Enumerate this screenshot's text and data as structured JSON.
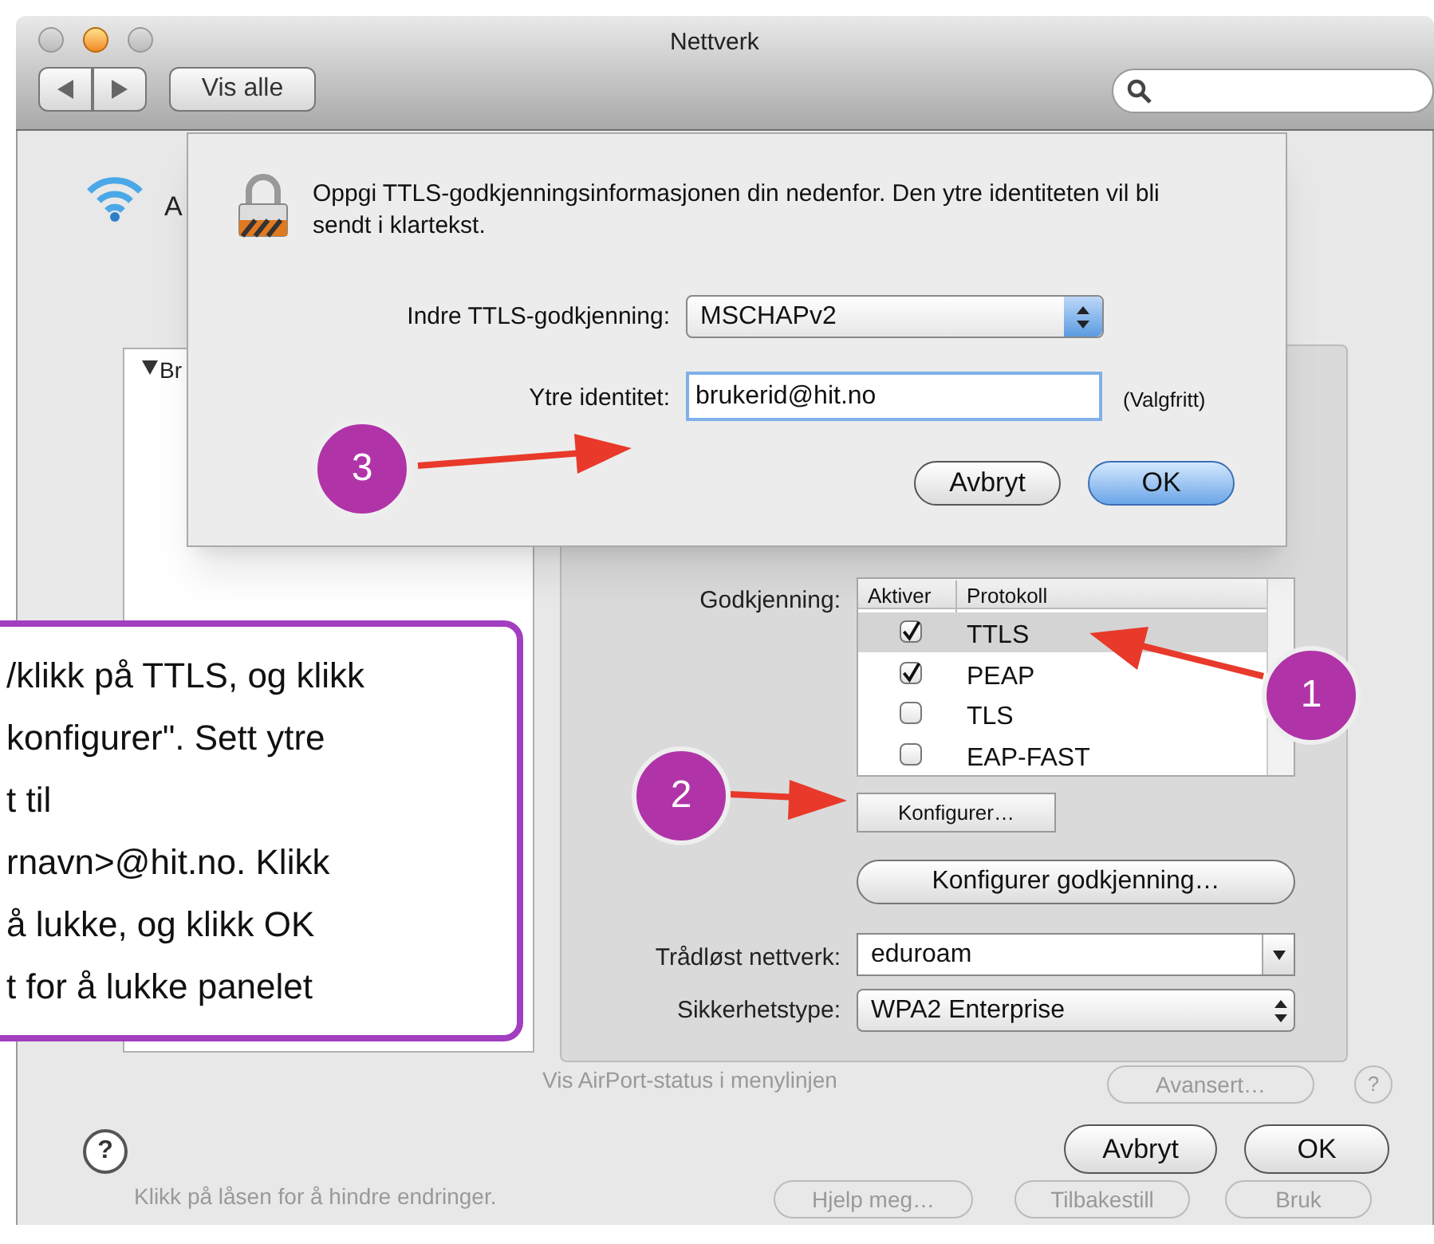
{
  "window": {
    "title": "Nettverk",
    "show_all": "Vis alle"
  },
  "background": {
    "service_label": "A",
    "show_status": "Vis AirPort-status i menylinjen",
    "advanced": "Avansert…",
    "help": "?",
    "lock_text": "Klikk på låsen for å hindre endringer.",
    "buttons": [
      "Hjelp meg…",
      "Tilbakestill",
      "Bruk"
    ]
  },
  "config_sheet": {
    "profiles": {
      "heading": "Br"
    },
    "authentication_label": "Godkjenning:",
    "table_columns": [
      "Aktiver",
      "Protokoll"
    ],
    "protocols": [
      {
        "protocol": "TTLS",
        "checked": true,
        "selected": true
      },
      {
        "protocol": "PEAP",
        "checked": true,
        "selected": false
      },
      {
        "protocol": "TLS",
        "checked": false,
        "selected": false
      },
      {
        "protocol": "EAP-FAST",
        "checked": false,
        "selected": false
      }
    ],
    "configure_button": "Konfigurer…",
    "configure_auth_button": "Konfigurer godkjenning…",
    "network_label": "Trådløst nettverk:",
    "network_value": "eduroam",
    "security_label": "Sikkerhetstype:",
    "security_value": "WPA2 Enterprise",
    "help": "?",
    "buttons": [
      {
        "label": "Avbryt",
        "default": false
      },
      {
        "label": "OK",
        "default": false
      }
    ]
  },
  "ttls_sheet": {
    "message": "Oppgi TTLS-godkjenningsinformasjonen din nedenfor. Den ytre identiteten vil bli sendt i klartekst.",
    "inner_label": "Indre TTLS-godkjenning:",
    "inner_value": "MSCHAPv2",
    "outer_label": "Ytre identitet:",
    "outer_value": "brukerid@hit.no",
    "optional_note": "(Valgfritt)",
    "buttons": [
      {
        "label": "Avbryt",
        "default": false
      },
      {
        "label": "OK",
        "default": true
      }
    ]
  },
  "annotations": {
    "badges": [
      "1",
      "2",
      "3"
    ],
    "callout_lines": [
      "/klikk på TTLS, og klikk",
      "konfigurer\". Sett ytre",
      "t til",
      "rnavn>@hit.no. Klikk",
      "å lukke, og klikk OK",
      "t for å lukke panelet"
    ]
  }
}
